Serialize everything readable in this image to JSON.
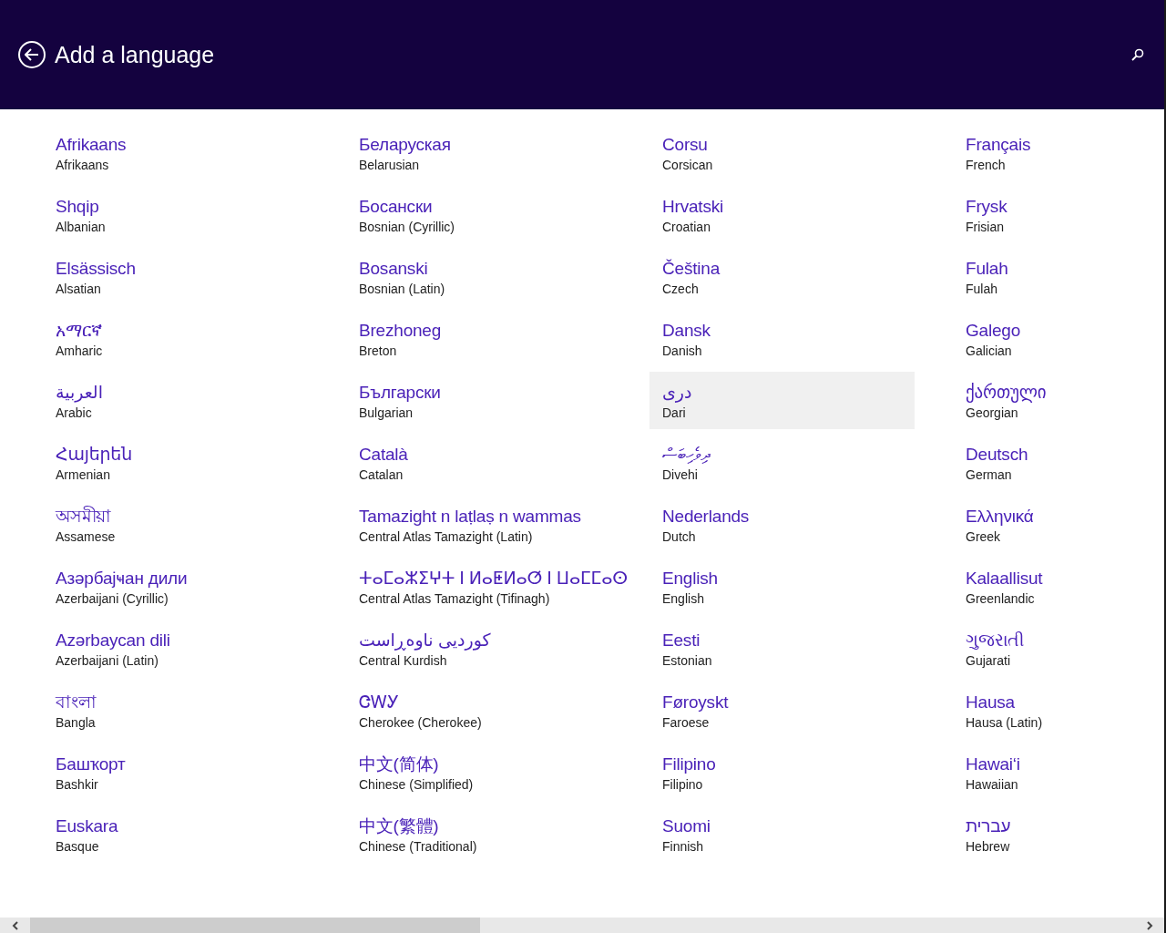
{
  "header": {
    "title": "Add a language"
  },
  "columns": [
    {
      "items": [
        {
          "native": "Afrikaans",
          "english": "Afrikaans",
          "selected": false
        },
        {
          "native": "Shqip",
          "english": "Albanian",
          "selected": false
        },
        {
          "native": "Elsässisch",
          "english": "Alsatian",
          "selected": false
        },
        {
          "native": "አማርኛ",
          "english": "Amharic",
          "selected": false
        },
        {
          "native": "العربية",
          "english": "Arabic",
          "selected": false
        },
        {
          "native": "Հայերեն",
          "english": "Armenian",
          "selected": false
        },
        {
          "native": "অসমীয়া",
          "english": "Assamese",
          "selected": false
        },
        {
          "native": "Азәрбајҹан дили",
          "english": "Azerbaijani (Cyrillic)",
          "selected": false
        },
        {
          "native": "Azərbaycan dili",
          "english": "Azerbaijani (Latin)",
          "selected": false
        },
        {
          "native": "বাংলা",
          "english": "Bangla",
          "selected": false
        },
        {
          "native": "Башҡорт",
          "english": "Bashkir",
          "selected": false
        },
        {
          "native": "Euskara",
          "english": "Basque",
          "selected": false
        }
      ]
    },
    {
      "items": [
        {
          "native": "Беларуская",
          "english": "Belarusian",
          "selected": false
        },
        {
          "native": "Босански",
          "english": "Bosnian (Cyrillic)",
          "selected": false
        },
        {
          "native": "Bosanski",
          "english": "Bosnian (Latin)",
          "selected": false
        },
        {
          "native": "Brezhoneg",
          "english": "Breton",
          "selected": false
        },
        {
          "native": "Български",
          "english": "Bulgarian",
          "selected": false
        },
        {
          "native": "Català",
          "english": "Catalan",
          "selected": false
        },
        {
          "native": "Tamazight n laṭlaṣ n wammas",
          "english": "Central Atlas Tamazight (Latin)",
          "selected": false
        },
        {
          "native": "ⵜⴰⵎⴰⵣⵉⵖⵜ ⵏ ⵍⴰⵟⵍⴰⵚ ⵏ ⵡⴰⵎⵎⴰⵙ",
          "english": "Central Atlas Tamazight (Tifinagh)",
          "selected": false
        },
        {
          "native": "کوردیی ناوەڕاست",
          "english": "Central Kurdish",
          "selected": false
        },
        {
          "native": "ᏣᎳᎩ",
          "english": "Cherokee (Cherokee)",
          "selected": false
        },
        {
          "native": "中文(简体)",
          "english": "Chinese (Simplified)",
          "selected": false
        },
        {
          "native": "中文(繁體)",
          "english": "Chinese (Traditional)",
          "selected": false
        }
      ]
    },
    {
      "items": [
        {
          "native": "Corsu",
          "english": "Corsican",
          "selected": false
        },
        {
          "native": "Hrvatski",
          "english": "Croatian",
          "selected": false
        },
        {
          "native": "Čeština",
          "english": "Czech",
          "selected": false
        },
        {
          "native": "Dansk",
          "english": "Danish",
          "selected": false
        },
        {
          "native": "درى",
          "english": "Dari",
          "selected": true
        },
        {
          "native": "ދިވެހިބަސް",
          "english": "Divehi",
          "selected": false
        },
        {
          "native": "Nederlands",
          "english": "Dutch",
          "selected": false
        },
        {
          "native": "English",
          "english": "English",
          "selected": false
        },
        {
          "native": "Eesti",
          "english": "Estonian",
          "selected": false
        },
        {
          "native": "Føroyskt",
          "english": "Faroese",
          "selected": false
        },
        {
          "native": "Filipino",
          "english": "Filipino",
          "selected": false
        },
        {
          "native": "Suomi",
          "english": "Finnish",
          "selected": false
        }
      ]
    },
    {
      "items": [
        {
          "native": "Français",
          "english": "French",
          "selected": false
        },
        {
          "native": "Frysk",
          "english": "Frisian",
          "selected": false
        },
        {
          "native": "Fulah",
          "english": "Fulah",
          "selected": false
        },
        {
          "native": "Galego",
          "english": "Galician",
          "selected": false
        },
        {
          "native": "ქართული",
          "english": "Georgian",
          "selected": false
        },
        {
          "native": "Deutsch",
          "english": "German",
          "selected": false
        },
        {
          "native": "Ελληνικά",
          "english": "Greek",
          "selected": false
        },
        {
          "native": "Kalaallisut",
          "english": "Greenlandic",
          "selected": false
        },
        {
          "native": "ગુજરાતી",
          "english": "Gujarati",
          "selected": false
        },
        {
          "native": "Hausa",
          "english": "Hausa (Latin)",
          "selected": false
        },
        {
          "native": "Hawaiʻi",
          "english": "Hawaiian",
          "selected": false
        },
        {
          "native": "עברית",
          "english": "Hebrew",
          "selected": false
        }
      ]
    }
  ]
}
